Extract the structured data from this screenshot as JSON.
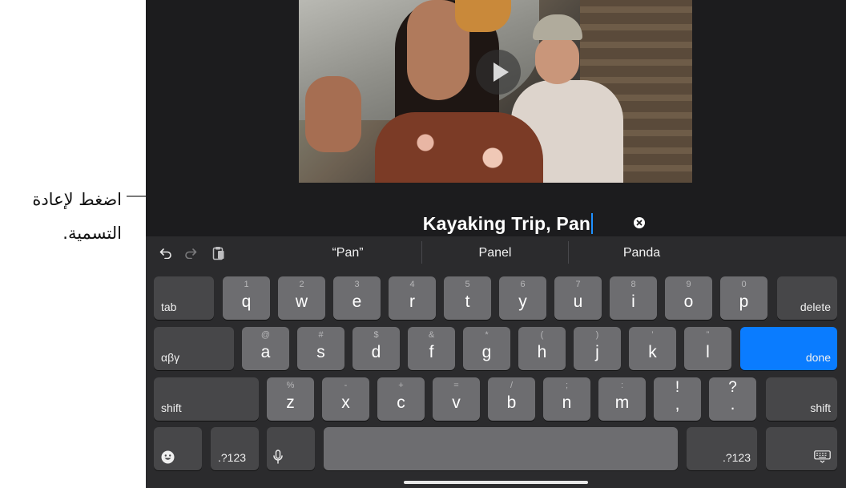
{
  "callout": {
    "line1": "اضغط لإعادة",
    "line2": "التسمية."
  },
  "title_field": {
    "value": "Kayaking Trip, Pan"
  },
  "predictions": {
    "items": [
      "“Pan”",
      "Panel",
      "Panda"
    ]
  },
  "keyboard": {
    "row1": [
      {
        "sub": "1",
        "main": "q"
      },
      {
        "sub": "2",
        "main": "w"
      },
      {
        "sub": "3",
        "main": "e"
      },
      {
        "sub": "4",
        "main": "r"
      },
      {
        "sub": "5",
        "main": "t"
      },
      {
        "sub": "6",
        "main": "y"
      },
      {
        "sub": "7",
        "main": "u"
      },
      {
        "sub": "8",
        "main": "i"
      },
      {
        "sub": "9",
        "main": "o"
      },
      {
        "sub": "0",
        "main": "p"
      }
    ],
    "row2": [
      {
        "sub": "@",
        "main": "a"
      },
      {
        "sub": "#",
        "main": "s"
      },
      {
        "sub": "$",
        "main": "d"
      },
      {
        "sub": "&",
        "main": "f"
      },
      {
        "sub": "*",
        "main": "g"
      },
      {
        "sub": "(",
        "main": "h"
      },
      {
        "sub": ")",
        "main": "j"
      },
      {
        "sub": "’",
        "main": "k"
      },
      {
        "sub": "”",
        "main": "l"
      }
    ],
    "row3": [
      {
        "sub": "%",
        "main": "z"
      },
      {
        "sub": "-",
        "main": "x"
      },
      {
        "sub": "+",
        "main": "c"
      },
      {
        "sub": "=",
        "main": "v"
      },
      {
        "sub": "/",
        "main": "b"
      },
      {
        "sub": ";",
        "main": "n"
      },
      {
        "sub": ":",
        "main": "m"
      },
      {
        "sub": "!",
        "main": ","
      },
      {
        "sub": "?",
        "main": "."
      }
    ],
    "tab": "tab",
    "delete": "delete",
    "alpha": "αβγ",
    "done": "done",
    "shift_left": "shift",
    "shift_right": "shift",
    "numbers_left": ".?123",
    "numbers_right": ".?123"
  },
  "colors": {
    "accent": "#0a7cff",
    "keyboard_bg": "#2b2b2d",
    "key": "#6d6d70",
    "key_dark": "#474749"
  }
}
